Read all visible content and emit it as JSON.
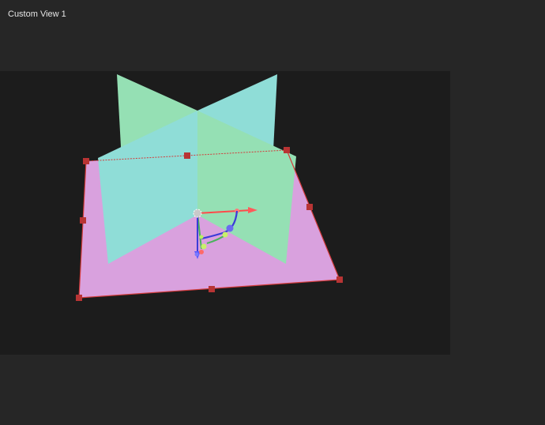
{
  "window": {
    "title": "Custom View 1"
  },
  "colors": {
    "background": "#262626",
    "viewport": "#1c1c1c",
    "ground_plane": "#d9a1de",
    "plane_green": "#95e0b4",
    "plane_cyan": "#8fddd7",
    "selection_outline": "#d33b3b",
    "handle": "#b83434",
    "axis_x": "#ff4a4a",
    "axis_y": "#49b25c",
    "axis_z": "#3b3bd8",
    "arc_yellow": "#c8f06a"
  },
  "icons": {
    "pivot": "pivot-origin-icon",
    "translate": "translate-gizmo-icon",
    "rotate": "rotate-arc-icon"
  }
}
